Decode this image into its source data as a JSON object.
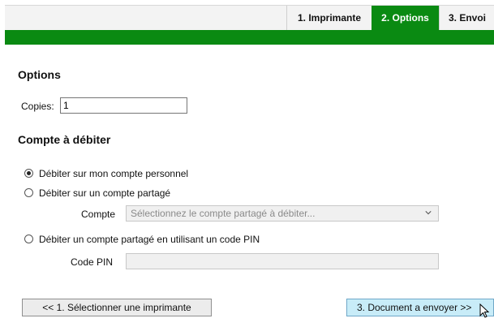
{
  "tabs": [
    {
      "label": "1. Imprimante",
      "active": false
    },
    {
      "label": "2. Options",
      "active": true
    },
    {
      "label": "3. Envoi",
      "active": false
    }
  ],
  "colors": {
    "accent_green": "#0a8a12",
    "next_button": "#c8ecf8"
  },
  "options": {
    "heading": "Options",
    "copies_label": "Copies:",
    "copies_value": "1"
  },
  "account": {
    "heading": "Compte à débiter",
    "radio_personal": "Débiter sur mon compte personnel",
    "radio_shared": "Débiter sur un compte partagé",
    "compte_label": "Compte",
    "compte_placeholder": "Sélectionnez le compte partagé à débiter...",
    "radio_pin": "Débiter un compte partagé en utilisant un code PIN",
    "pin_label": "Code PIN",
    "selected": "personal"
  },
  "buttons": {
    "back": "<< 1. Sélectionner une imprimante",
    "next": "3. Document a envoyer >>"
  },
  "icons": {
    "select_arrow": "chevron-down-icon",
    "cursor": "pointer-cursor-icon"
  }
}
